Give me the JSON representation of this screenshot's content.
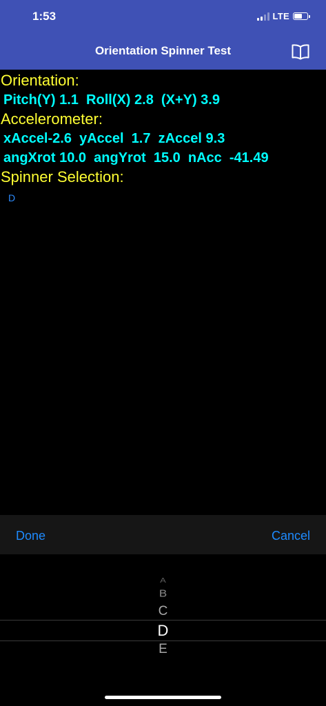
{
  "status_bar": {
    "time": "1:53",
    "network": "LTE"
  },
  "nav": {
    "title": "Orientation Spinner Test",
    "right_icon": "book-icon"
  },
  "orientation": {
    "heading": "Orientation:",
    "line": "Pitch(Y) 1.1  Roll(X) 2.8  (X+Y) 3.9"
  },
  "accelerometer": {
    "heading": "Accelerometer:",
    "line1": "xAccel-2.6  yAccel  1.7  zAccel 9.3",
    "line2": "angXrot 10.0  angYrot  15.0  nAcc  -41.49"
  },
  "spinner": {
    "heading": "Spinner Selection:",
    "value": "D"
  },
  "toolbar": {
    "done_label": "Done",
    "cancel_label": "Cancel"
  },
  "picker": {
    "items": [
      "A",
      "B",
      "C",
      "D",
      "E"
    ],
    "selected": "D"
  },
  "colors": {
    "nav_background": "#3f51b5",
    "heading": "#ffff33",
    "readout": "#00ffff",
    "link": "#1e8bff"
  }
}
